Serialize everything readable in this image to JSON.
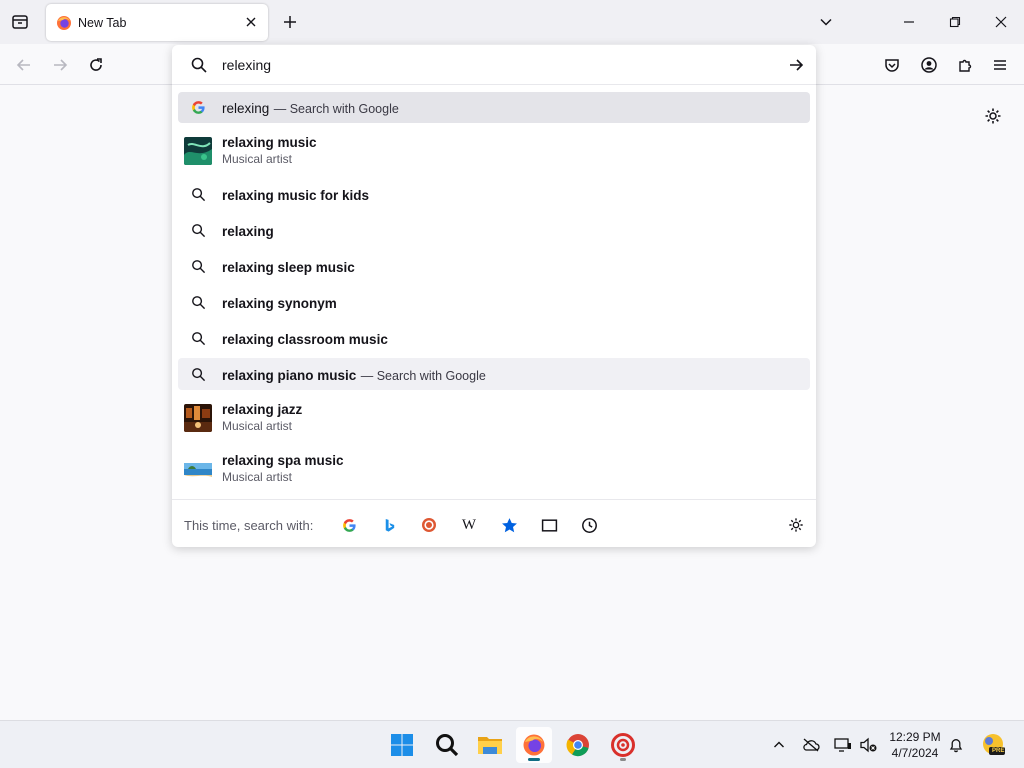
{
  "tab": {
    "title": "New Tab"
  },
  "urlbar": {
    "query": "relexing",
    "results": [
      {
        "kind": "search",
        "main": "relexing",
        "action": "— Search with Google",
        "icon": "google-icon",
        "bold": false,
        "state": "selected"
      },
      {
        "kind": "entity",
        "main": "relaxing music",
        "sub": "Musical artist",
        "thumb": "green-abstract"
      },
      {
        "kind": "suggestion",
        "main": "relaxing music for kids"
      },
      {
        "kind": "suggestion",
        "main": "relaxing"
      },
      {
        "kind": "suggestion",
        "main": "relaxing sleep music"
      },
      {
        "kind": "suggestion",
        "main": "relaxing synonym"
      },
      {
        "kind": "suggestion",
        "main": "relaxing classroom music"
      },
      {
        "kind": "suggestion",
        "main": "relaxing piano music",
        "action": "— Search with Google",
        "state": "hover"
      },
      {
        "kind": "entity",
        "main": "relaxing jazz",
        "sub": "Musical artist",
        "thumb": "dark-warm"
      },
      {
        "kind": "entity",
        "main": "relaxing spa music",
        "sub": "Musical artist",
        "thumb": "beach"
      }
    ],
    "oneoff": {
      "label": "This time, search with:",
      "engines": [
        "google-icon",
        "bing-icon",
        "duckduckgo-icon",
        "wikipedia-icon",
        "bookmarks-star-icon",
        "tabs-icon",
        "history-clock-icon"
      ],
      "wikipedia_glyph": "W"
    }
  },
  "taskbar": {
    "time": "12:29 PM",
    "date": "4/7/2024",
    "badge": "PRE"
  },
  "colors": {
    "accent": "#0061e0",
    "selected_row": "#e4e4e9",
    "hover_row": "#f0f0f4"
  }
}
